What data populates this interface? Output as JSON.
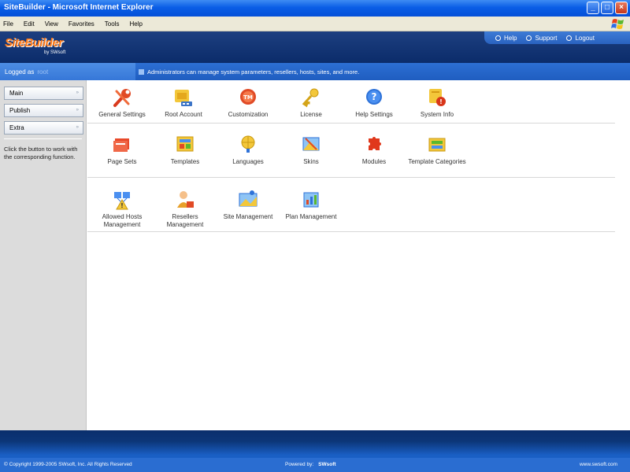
{
  "window": {
    "title": "SiteBuilder - Microsoft Internet Explorer",
    "min": "_",
    "max": "□",
    "close": "×"
  },
  "menu": [
    "File",
    "Edit",
    "View",
    "Favorites",
    "Tools",
    "Help"
  ],
  "brand": {
    "name": "SiteBuilder",
    "by": "by SWsoft"
  },
  "toplinks": [
    "Help",
    "Support",
    "Logout"
  ],
  "login": {
    "label": "Logged as",
    "user": "root"
  },
  "notice": "Administrators can manage system parameters, resellers, hosts, sites, and more.",
  "sidebar": {
    "buttons": [
      "Main",
      "Publish",
      "Extra"
    ],
    "arrows": "»",
    "hint": "Click the button to work with the corresponding function."
  },
  "rows": [
    {
      "tools": [
        {
          "label": "General Settings",
          "icon": "wrench-icon"
        },
        {
          "label": "Root Account",
          "icon": "root-account-icon"
        },
        {
          "label": "Customization",
          "icon": "customization-icon"
        },
        {
          "label": "License",
          "icon": "license-key-icon"
        },
        {
          "label": "Help Settings",
          "icon": "help-icon"
        },
        {
          "label": "System Info",
          "icon": "system-info-icon"
        }
      ]
    },
    {
      "tools": [
        {
          "label": "Page Sets",
          "icon": "page-sets-icon"
        },
        {
          "label": "Templates",
          "icon": "templates-icon"
        },
        {
          "label": "Languages",
          "icon": "languages-icon"
        },
        {
          "label": "Skins",
          "icon": "skins-icon"
        },
        {
          "label": "Modules",
          "icon": "modules-icon"
        },
        {
          "label": "Template Categories",
          "icon": "template-categories-icon"
        }
      ]
    },
    {
      "tools": [
        {
          "label": "Allowed Hosts Management",
          "icon": "allowed-hosts-icon"
        },
        {
          "label": "Resellers Management",
          "icon": "resellers-icon"
        },
        {
          "label": "Site Management",
          "icon": "site-management-icon"
        },
        {
          "label": "Plan Management",
          "icon": "plan-management-icon"
        }
      ]
    }
  ],
  "footer": {
    "copyright": "© Copyright 1999-2005 SWsoft, Inc. All Rights Reserved",
    "powered": "Powered by:",
    "powered_brand": "SWsoft",
    "site": "www.swsoft.com"
  },
  "colors": {
    "header": "#0b2c6a",
    "accent": "#2a6dd1",
    "brand": "#ff7b1a"
  }
}
